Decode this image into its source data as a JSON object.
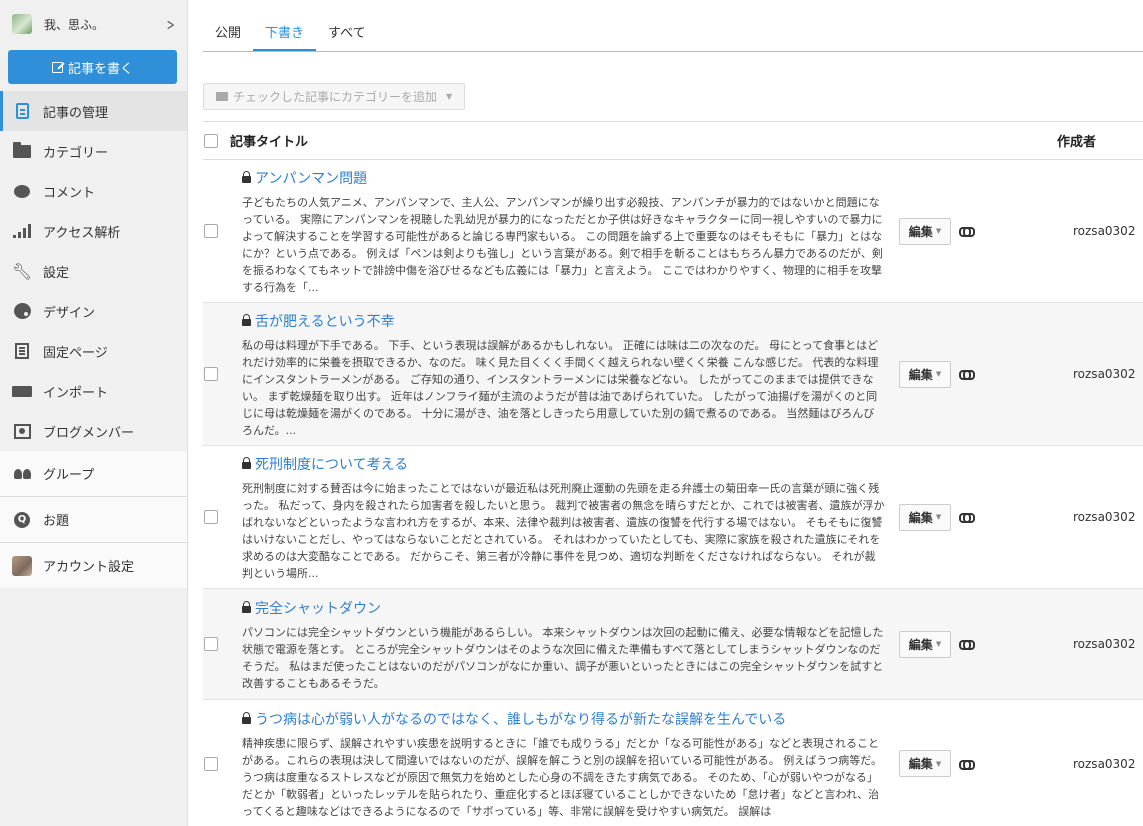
{
  "sidebar": {
    "blog_name": "我、思ふ。",
    "write_button": "記事を書く",
    "items": [
      {
        "label": "記事の管理",
        "icon": "document-icon"
      },
      {
        "label": "カテゴリー",
        "icon": "folder-icon"
      },
      {
        "label": "コメント",
        "icon": "comment-icon"
      },
      {
        "label": "アクセス解析",
        "icon": "bar-chart-icon"
      },
      {
        "label": "設定",
        "icon": "wrench-icon"
      },
      {
        "label": "デザイン",
        "icon": "palette-icon"
      },
      {
        "label": "固定ページ",
        "icon": "page-icon"
      },
      {
        "label": "インポート",
        "icon": "truck-icon"
      },
      {
        "label": "ブログメンバー",
        "icon": "member-icon"
      },
      {
        "label": "グループ",
        "icon": "group-icon"
      },
      {
        "label": "お題",
        "icon": "q-icon"
      },
      {
        "label": "アカウント設定",
        "icon": "account-avatar"
      }
    ]
  },
  "tabs": [
    {
      "label": "公開"
    },
    {
      "label": "下書き"
    },
    {
      "label": "すべて"
    }
  ],
  "category_button": "チェックした記事にカテゴリーを追加",
  "list_header": {
    "title": "記事タイトル",
    "author": "作成者"
  },
  "edit_label": "編集",
  "entries": [
    {
      "title": "アンパンマン問題",
      "excerpt": "子どもたちの人気アニメ、アンパンマンで、主人公、アンパンマンが繰り出す必殺技、アンパンチが暴力的ではないかと問題になっている。 実際にアンパンマンを視聴した乳幼児が暴力的になっただとか子供は好きなキャラクターに同一視しやすいので暴力によって解決することを学習する可能性があると論じる専門家もいる。 この問題を論ずる上で重要なのはそもそもに「暴力」とはなにか？という点である。 例えば「ペンは剣よりも強し」という言葉がある。剣で相手を斬ることはもちろん暴力であるのだが、剣を振るわなくてもネットで誹謗中傷を浴びせるなども広義には「暴力」と言えよう。 ここではわかりやすく、物理的に相手を攻撃する行為を「...",
      "author": "rozsa0302"
    },
    {
      "title": "舌が肥えるという不幸",
      "excerpt": "私の母は料理が下手である。 下手、という表現は誤解があるかもしれない。 正確には味は二の次なのだ。 母にとって食事とはどれだけ効率的に栄養を摂取できるか、なのだ。 味く見た目くくく手間くく越えられない壁くく栄養 こんな感じだ。 代表的な料理にインスタントラーメンがある。 ご存知の通り、インスタントラーメンには栄養などない。 したがってこのままでは提供できない。 まず乾燥麺を取り出す。 近年はノンフライ麺が主流のようだが昔は油であげられていた。 したがって油揚げを湯がくのと同じに母は乾燥麺を湯がくのである。 十分に湯がき、油を落としきったら用意していた別の鍋で煮るのである。 当然麺はびろんびろんだ。...",
      "author": "rozsa0302"
    },
    {
      "title": "死刑制度について考える",
      "excerpt": "死刑制度に対する賛否は今に始まったことではないが最近私は死刑廃止運動の先頭を走る弁護士の菊田幸一氏の言葉が頭に強く残った。 私だって、身内を殺されたら加害者を殺したいと思う。 裁判で被害者の無念を晴らすだとか、これでは被害者、遺族が浮かばれないなどといったような言われ方をするが、本来、法律や裁判は被害者、遺族の復讐を代行する場ではない。 そもそもに復讐はいけないことだし、やってはならないことだとされている。 それはわかっていたとしても、実際に家族を殺された遺族にそれを求めるのは大変酷なことである。 だからこそ、第三者が冷静に事件を見つめ、適切な判断をくださなければならない。 それが裁判という場所...",
      "author": "rozsa0302"
    },
    {
      "title": "完全シャットダウン",
      "excerpt": "パソコンには完全シャットダウンという機能があるらしい。 本来シャットダウンは次回の起動に備え、必要な情報などを記憶した状態で電源を落とす。 ところが完全シャットダウンはそのような次回に備えた準備もすべて落としてしまうシャットダウンなのだそうだ。 私はまだ使ったことはないのだがパソコンがなにか重い、調子が悪いといったときにはこの完全シャットダウンを試すと改善することもあるそうだ。",
      "author": "rozsa0302"
    },
    {
      "title": "うつ病は心が弱い人がなるのではなく、誰しもがなり得るが新たな誤解を生んでいる",
      "excerpt": "精神疾患に限らず、誤解されやすい疾患を説明するときに「誰でも成りうる」だとか「なる可能性がある」などと表現されることがある。これらの表現は決して間違いではないのだが、誤解を解こうと別の誤解を招いている可能性がある。 例えばうつ病等だ。 うつ病は度重なるストレスなどが原因で無気力を始めとした心身の不調をきたす病気である。 そのため、「心が弱いやつがなる」だとか「軟弱者」といったレッテルを貼られたり、重症化するとほぼ寝ていることしかできないため「怠け者」などと言われ、治ってくると趣味などはできるようになるので「サボっている」等、非常に誤解を受けやすい病気だ。 誤解は",
      "author": "rozsa0302"
    }
  ]
}
